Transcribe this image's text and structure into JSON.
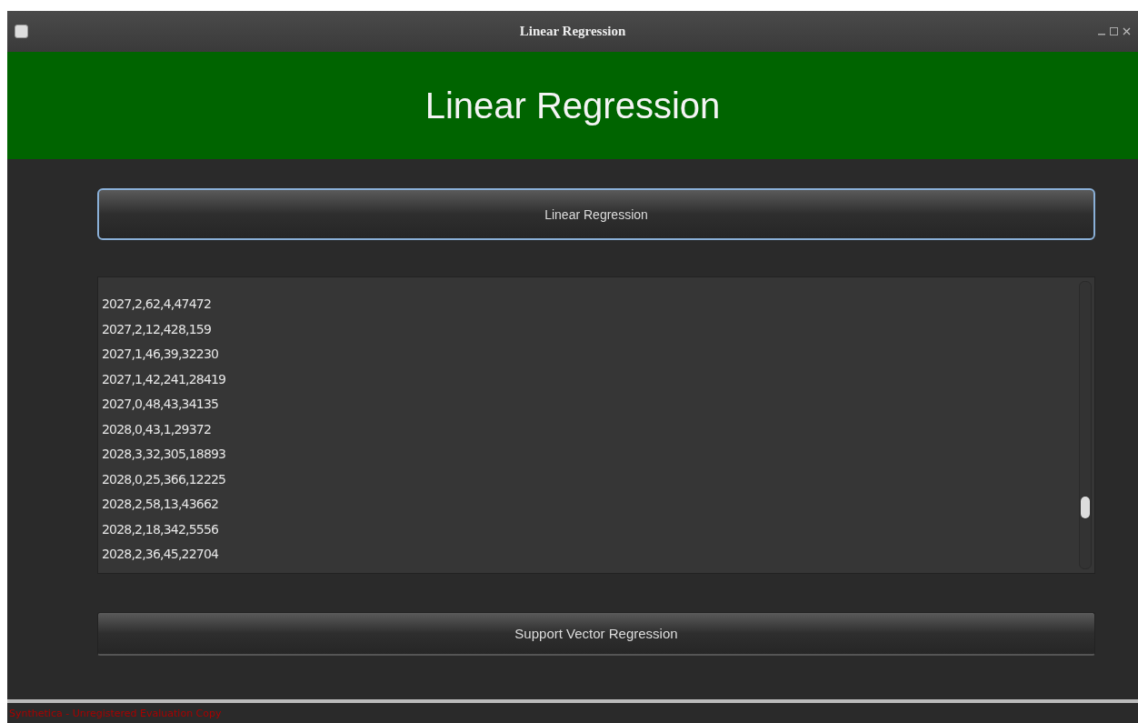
{
  "window": {
    "title": "Linear Regression"
  },
  "header": {
    "title": "Linear Regression"
  },
  "buttons": [
    {
      "label": "Linear Regression",
      "focused": true
    },
    {
      "label": "Support Vector Regression",
      "focused": false
    }
  ],
  "list": {
    "items": [
      "2027,2,62,4,47472",
      "2027,2,12,428,159",
      "2027,1,46,39,32230",
      "2027,1,42,241,28419",
      "2027,0,48,43,34135",
      "2028,0,43,1,29372",
      "2028,3,32,305,18893",
      "2028,0,25,366,12225",
      "2028,2,58,13,43662",
      "2028,2,18,342,5556",
      "2028,2,36,45,22704"
    ]
  },
  "status_bar": {
    "text": "Synthetica - Unregistered Evaluation Copy"
  }
}
